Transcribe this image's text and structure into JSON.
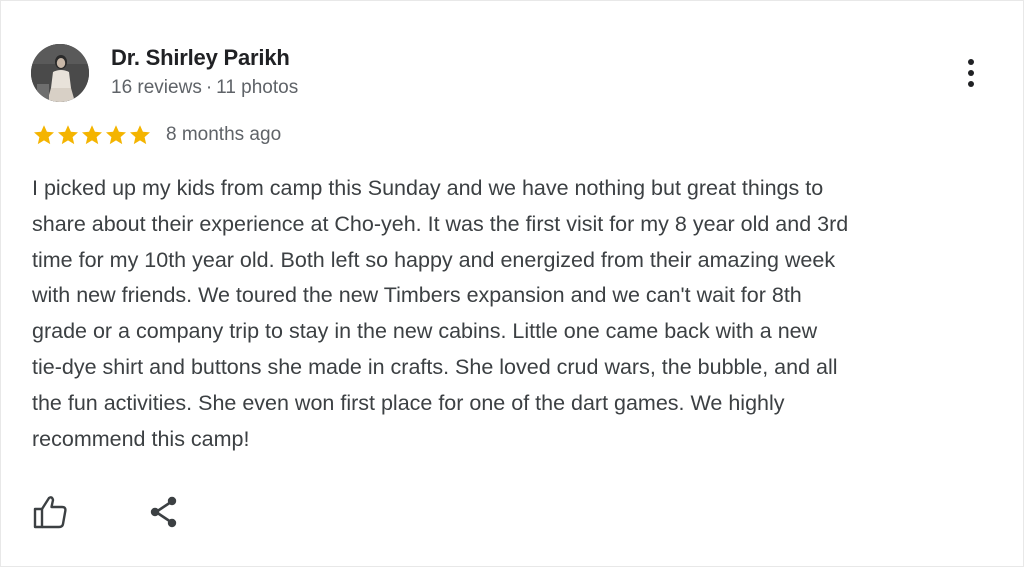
{
  "review": {
    "author_name": "Dr. Shirley Parikh",
    "reviews_count": "16 reviews",
    "separator": "·",
    "photos_count": "11 photos",
    "rating": 5,
    "rating_max": 5,
    "time_ago": "8 months ago",
    "text_lines": [
      "I picked up my kids from camp this Sunday and we have nothing but great things to",
      "share about their experience at Cho-yeh. It was the first visit for my 8 year old and 3rd",
      "time for my 10th year old. Both left so happy and energized from their amazing week",
      "with new friends. We toured the new Timbers expansion and we can't wait for 8th",
      "grade or a company trip to stay in the new cabins. Little one came back with a new",
      "tie-dye shirt and buttons she made in crafts. She loved crud wars, the bubble, and all",
      "the fun activities. She even won first place for one of the dart games. We highly",
      "recommend this camp!"
    ]
  },
  "icons": {
    "more": "more-vertical-icon",
    "like": "thumbs-up-icon",
    "share": "share-icon",
    "star": "star-icon"
  },
  "colors": {
    "star": "#f4b400",
    "name": "#202124",
    "secondary": "#5f6368",
    "body": "#3c4043"
  }
}
